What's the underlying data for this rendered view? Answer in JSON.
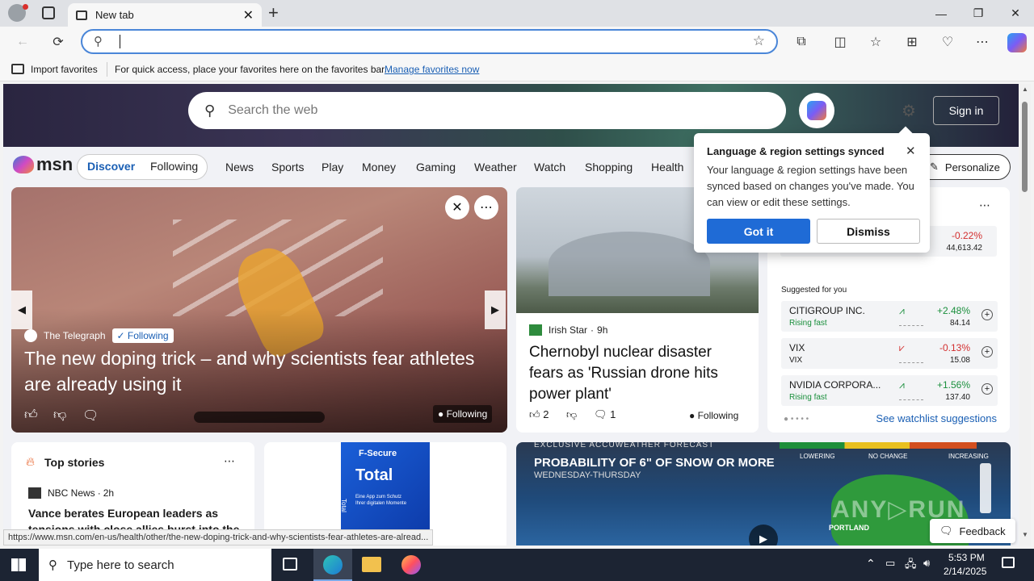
{
  "browser": {
    "tab_title": "New tab",
    "address_value": "",
    "fav_import": "Import favorites",
    "fav_message": "For quick access, place your favorites here on the favorites bar.",
    "fav_link": "Manage favorites now"
  },
  "msn": {
    "search_placeholder": "Search the web",
    "sign_in": "Sign in",
    "logo": "msn",
    "nav_discover": "Discover",
    "nav_following": "Following",
    "nav_items": [
      "News",
      "Sports",
      "Play",
      "Money",
      "Gaming",
      "Weather",
      "Watch",
      "Shopping",
      "Health"
    ],
    "personalize": "Personalize"
  },
  "hero_story": {
    "source": "The Telegraph",
    "following": "Following",
    "headline": "The new doping trick – and why scientists fear athletes are already using it",
    "following_badge": "Following"
  },
  "story2": {
    "source": "Irish Star",
    "time": "9h",
    "headline": "Chernobyl nuclear disaster fears as 'Russian drone hits power plant'",
    "likes": "2",
    "comments": "1",
    "following": "Following"
  },
  "popup": {
    "title": "Language & region settings synced",
    "body": "Your language & region settings have been synced based on changes you've made. You can view or edit these settings.",
    "got_it": "Got it",
    "dismiss": "Dismiss"
  },
  "watchlist": {
    "top_change": "-0.22%",
    "top_value": "44,613.42",
    "suggested_label": "Suggested for you",
    "stocks": [
      {
        "name": "CITIGROUP INC.",
        "sub": "Rising fast",
        "change": "+2.48%",
        "price": "84.14"
      },
      {
        "name": "VIX",
        "sub": "VIX",
        "change": "-0.13%",
        "price": "15.08"
      },
      {
        "name": "NVIDIA CORPORA...",
        "sub": "Rising fast",
        "change": "+1.56%",
        "price": "137.40"
      }
    ],
    "see_more": "See watchlist suggestions",
    "colors": {
      "up": "#1a8f3c",
      "down": "#d32f2f"
    }
  },
  "top_stories": {
    "title": "Top stories",
    "source": "NBC News",
    "time": "2h",
    "headline": "Vance berates European leaders as tensions with close allies burst into the"
  },
  "ad": {
    "brand": "F-Secure",
    "product": "Total",
    "side": "Total",
    "tagline": "Eine App zum Schutz Ihrer digitalen Momente"
  },
  "weather": {
    "banner": "EXCLUSIVE ACCUWEATHER FORECAST",
    "headline": "PROBABILITY OF 6\" OF SNOW OR MORE",
    "sub": "WEDNESDAY-THURSDAY",
    "legend": [
      "LOWERING",
      "NO CHANGE",
      "INCREASING"
    ],
    "city": "PORTLAND"
  },
  "feedback": "Feedback",
  "status_url": "https://www.msn.com/en-us/health/other/the-new-doping-trick-and-why-scientists-fear-athletes-are-alread...",
  "taskbar": {
    "search_placeholder": "Type here to search",
    "time": "5:53 PM",
    "date": "2/14/2025"
  }
}
